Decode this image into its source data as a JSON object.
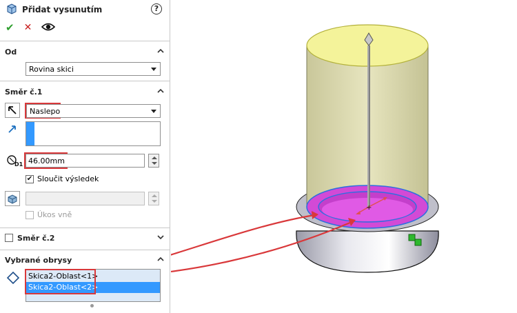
{
  "panel": {
    "title": "Přidat vysunutím",
    "help_label": "?",
    "sections": {
      "from": {
        "header": "Od",
        "combo_value": "Rovina skici"
      },
      "direction1": {
        "header": "Směr č.1",
        "end_condition": "Naslepo",
        "depth_value": "46.00mm",
        "merge_label": "Sloučit výsledek",
        "draft_label": "Úkos vně"
      },
      "direction2": {
        "header": "Směr č.2"
      },
      "contours": {
        "header": "Vybrané obrysy",
        "items": [
          "Skica2-Oblast<1>",
          "Skica2-Oblast<2>"
        ]
      }
    },
    "icon_text": {
      "depth": "D1"
    }
  },
  "colors": {
    "accent_red": "#d9383a",
    "selection_blue": "#3399ff",
    "list_bg": "#dce9f7",
    "cylinder_fill": "#dedcb0",
    "top_face": "#f4f39a",
    "ring_magenta": "#d24ad6",
    "body_shade": "#c6c6d2",
    "arrow_red": "#e05050",
    "ok_green": "#2e9e2e",
    "cancel_red": "#c81e1e"
  },
  "icons": [
    "extrude-feature-icon",
    "help-icon",
    "ok-icon",
    "cancel-icon",
    "preview-eye-icon",
    "chevron-up-icon",
    "chevron-down-icon",
    "reverse-direction-icon",
    "direction-vector-icon",
    "depth-dimension-icon",
    "draft-icon",
    "contour-diamond-icon"
  ]
}
